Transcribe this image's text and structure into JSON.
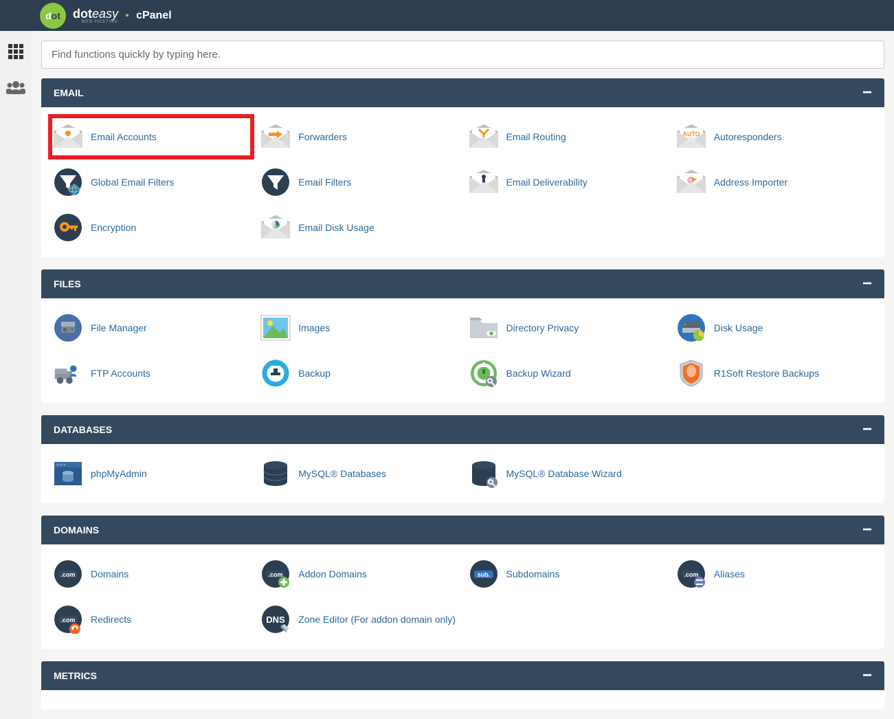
{
  "header": {
    "brand_left": "dot",
    "brand_right": "easy",
    "brand_sub": "WEB HOSTING",
    "app": "cPanel"
  },
  "search": {
    "placeholder": "Find functions quickly by typing here."
  },
  "panels": {
    "email": {
      "title": "EMAIL",
      "items": {
        "accounts": "Email Accounts",
        "forwarders": "Forwarders",
        "routing": "Email Routing",
        "autoresponders": "Autoresponders",
        "global_filters": "Global Email Filters",
        "email_filters": "Email Filters",
        "deliverability": "Email Deliverability",
        "address_importer": "Address Importer",
        "encryption": "Encryption",
        "disk_usage": "Email Disk Usage"
      }
    },
    "files": {
      "title": "FILES",
      "items": {
        "file_manager": "File Manager",
        "images": "Images",
        "directory_privacy": "Directory Privacy",
        "disk_usage": "Disk Usage",
        "ftp_accounts": "FTP Accounts",
        "backup": "Backup",
        "backup_wizard": "Backup Wizard",
        "r1soft": "R1Soft Restore Backups"
      }
    },
    "databases": {
      "title": "DATABASES",
      "items": {
        "phpmyadmin": "phpMyAdmin",
        "mysql_db": "MySQL® Databases",
        "mysql_wizard": "MySQL® Database Wizard"
      }
    },
    "domains": {
      "title": "DOMAINS",
      "items": {
        "domains": "Domains",
        "addon": "Addon Domains",
        "subdomains": "Subdomains",
        "aliases": "Aliases",
        "redirects": "Redirects",
        "zone_editor": "Zone Editor (For addon domain only)"
      }
    },
    "metrics": {
      "title": "METRICS"
    }
  }
}
